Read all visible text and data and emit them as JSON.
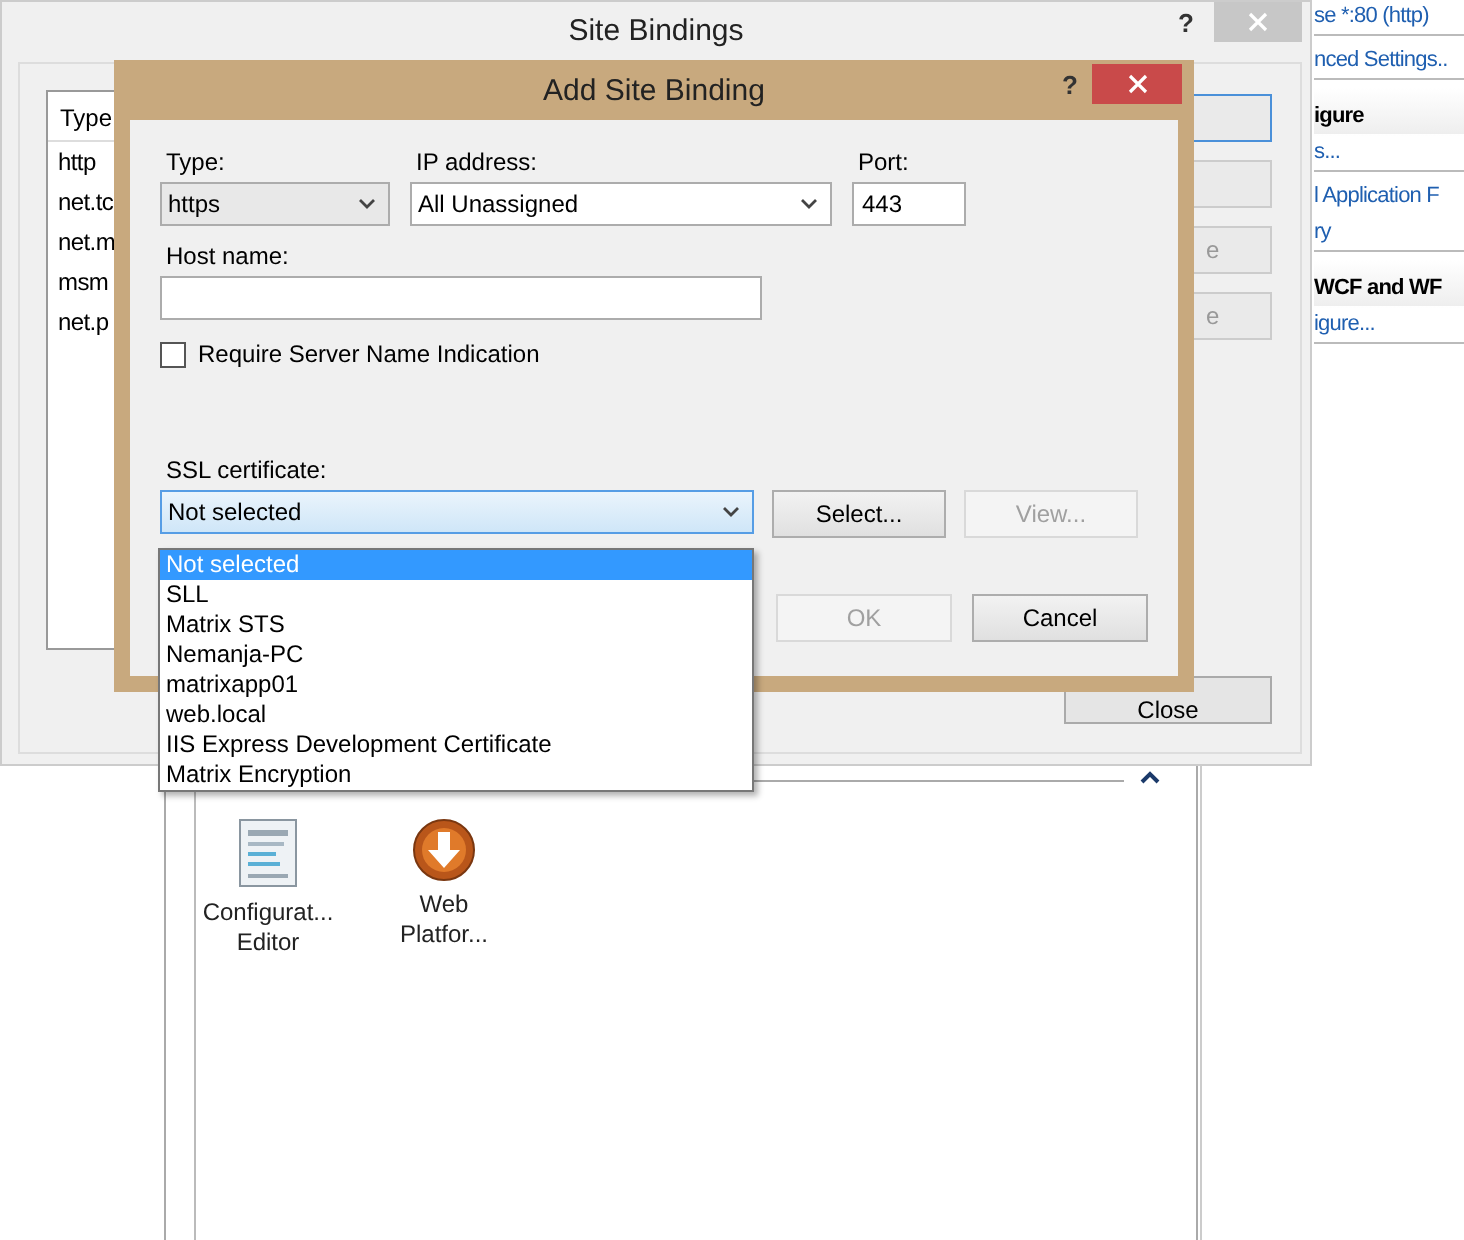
{
  "side_panel": {
    "items": [
      {
        "kind": "link",
        "text": "se *:80 (http)",
        "divider": true
      },
      {
        "kind": "link",
        "text": "nced Settings..",
        "divider": true
      },
      {
        "kind": "header",
        "text": "igure",
        "divider": false
      },
      {
        "kind": "link",
        "text": "s...",
        "divider": true
      },
      {
        "kind": "link",
        "text": "l Application F",
        "divider": false
      },
      {
        "kind": "link",
        "text": "ry",
        "divider": true
      },
      {
        "kind": "header",
        "text": "WCF and WF",
        "divider": false
      },
      {
        "kind": "link",
        "text": "igure...",
        "divider": true
      }
    ]
  },
  "features_view": {
    "items": [
      {
        "kind": "config",
        "lines": [
          "Configurat...",
          "Editor"
        ]
      },
      {
        "kind": "download",
        "lines": [
          "Web",
          "Platfor..."
        ]
      }
    ]
  },
  "site_bindings": {
    "title": "Site Bindings",
    "help": "?",
    "list": {
      "header": "Type",
      "rows": [
        "http",
        "net.tc",
        "net.m",
        "msm",
        "net.p"
      ]
    },
    "buttons": [
      {
        "focused": true
      },
      {
        "focused": false
      },
      {
        "label": "e",
        "focused": false
      },
      {
        "label": "e",
        "focused": false
      }
    ],
    "close_button": "Close"
  },
  "dialog": {
    "title": "Add Site Binding",
    "help": "?",
    "type": {
      "label": "Type:",
      "value": "https"
    },
    "ip_address": {
      "label": "IP address:",
      "value": "All Unassigned"
    },
    "port": {
      "label": "Port:",
      "value": "443"
    },
    "host_name": {
      "label": "Host name:"
    },
    "sni": {
      "label": "Require Server Name Indication",
      "checked": false
    },
    "ssl_certificate": {
      "label": "SSL certificate:",
      "value": "Not selected",
      "expanded": true,
      "options": [
        {
          "text": "Not selected",
          "selected": true
        },
        {
          "text": "SLL",
          "selected": false
        },
        {
          "text": "Matrix STS",
          "selected": false
        },
        {
          "text": "Nemanja-PC",
          "selected": false
        },
        {
          "text": "matrixapp01",
          "selected": false
        },
        {
          "text": "web.local",
          "selected": false
        },
        {
          "text": "IIS Express Development Certificate",
          "selected": false
        },
        {
          "text": "Matrix Encryption",
          "selected": false
        }
      ]
    },
    "select_button": {
      "label": "Select...",
      "disabled": false
    },
    "view_button": {
      "label": "View...",
      "disabled": true
    },
    "ok_button": {
      "label": "OK",
      "disabled": true
    },
    "cancel_button": {
      "label": "Cancel",
      "disabled": false
    }
  }
}
